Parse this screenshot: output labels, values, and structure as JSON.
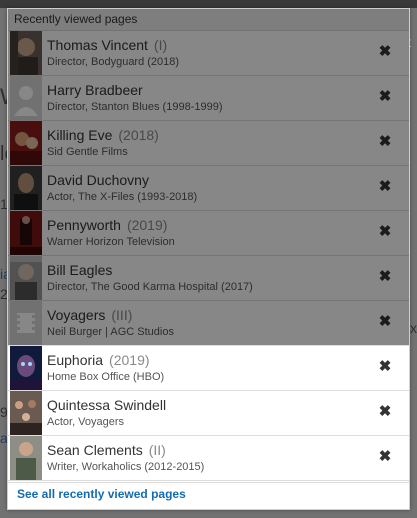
{
  "panel": {
    "header": "Recently viewed pages",
    "footer_link": "See all recently viewed pages"
  },
  "background_fragments": {
    "right_top": "it",
    "left_w": "W",
    "left_le": "le",
    "left_1": "1",
    "left_ia": "ia",
    "left_2": "2",
    "left_9": "9",
    "left_a": "a",
    "right_x": "x"
  },
  "items": [
    {
      "title": "Thomas Vincent",
      "meta": "(I)",
      "subtitle": "Director, Bodyguard (2018)",
      "thumb": "person-photo",
      "highlighted": false
    },
    {
      "title": "Harry Bradbeer",
      "meta": "",
      "subtitle": "Director, Stanton Blues (1998-1999)",
      "thumb": "person-placeholder-icon",
      "highlighted": false
    },
    {
      "title": "Killing Eve",
      "meta": "(2018)",
      "subtitle": "Sid Gentle Films",
      "thumb": "poster",
      "highlighted": false
    },
    {
      "title": "David Duchovny",
      "meta": "",
      "subtitle": "Actor, The X-Files (1993-2018)",
      "thumb": "person-photo",
      "highlighted": false
    },
    {
      "title": "Pennyworth",
      "meta": "(2019)",
      "subtitle": "Warner Horizon Television",
      "thumb": "poster",
      "highlighted": false
    },
    {
      "title": "Bill Eagles",
      "meta": "",
      "subtitle": "Director, The Good Karma Hospital (2017)",
      "thumb": "person-photo",
      "highlighted": false
    },
    {
      "title": "Voyagers",
      "meta": "(III)",
      "subtitle": "Neil Burger | AGC Studios",
      "thumb": "film-placeholder-icon",
      "highlighted": false
    },
    {
      "title": "Euphoria",
      "meta": "(2019)",
      "subtitle": "Home Box Office (HBO)",
      "thumb": "poster",
      "highlighted": true
    },
    {
      "title": "Quintessa Swindell",
      "meta": "",
      "subtitle": "Actor, Voyagers",
      "thumb": "person-photo",
      "highlighted": true
    },
    {
      "title": "Sean Clements",
      "meta": "(II)",
      "subtitle": "Writer, Workaholics (2012-2015)",
      "thumb": "person-photo",
      "highlighted": true
    }
  ],
  "close_glyph": "✖"
}
